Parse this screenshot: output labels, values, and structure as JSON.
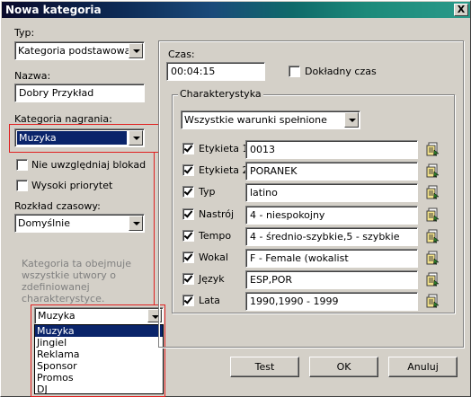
{
  "window": {
    "title": "Nowa kategoria",
    "close": "X"
  },
  "left": {
    "type_label": "Typ:",
    "type_value": "Kategoria podstawowa",
    "name_label": "Nazwa:",
    "name_value": "Dobry Przykład",
    "rec_cat_label": "Kategoria nagrania:",
    "rec_cat_value": "Muzyka",
    "ignore_locks_label": "Nie uwzględniaj blokad",
    "high_priority_label": "Wysoki priorytet",
    "schedule_label": "Rozkład czasowy:",
    "schedule_value": "Domyślnie",
    "info_text": [
      "Kategoria ta obejmuje",
      "wszystkie utwory o",
      "zdefiniowanej",
      "charakterystyce."
    ]
  },
  "dropdown": {
    "value": "Muzyka",
    "options": [
      "Muzyka",
      "Jingiel",
      "Reklama",
      "Sponsor",
      "Promos",
      "DJ"
    ],
    "highlighted": "Muzyka"
  },
  "right": {
    "time_label": "Czas:",
    "time_value": "00:04:15",
    "exact_time_label": "Dokładny czas",
    "group_title": "Charakterystyka",
    "condition_value": "Wszystkie warunki spełnione",
    "rows": [
      {
        "label": "Etykieta 1",
        "value": "0013",
        "checked": true
      },
      {
        "label": "Etykieta 2",
        "value": "PORANEK",
        "checked": true
      },
      {
        "label": "Typ",
        "value": "latino",
        "checked": true
      },
      {
        "label": "Nastrój",
        "value": "4 - niespokojny",
        "checked": true
      },
      {
        "label": "Tempo",
        "value": "4 - średnio-szybkie,5 - szybkie",
        "checked": true
      },
      {
        "label": "Wokal",
        "value": "F - Female (wokalist",
        "checked": true
      },
      {
        "label": "Język",
        "value": "ESP,POR",
        "checked": true
      },
      {
        "label": "Lata",
        "value": "1990,1990 - 1999",
        "checked": true
      }
    ]
  },
  "buttons": {
    "test": "Test",
    "ok": "OK",
    "cancel": "Anuluj"
  },
  "colors": {
    "highlight": "#0a246a",
    "annotation": "#e02020"
  }
}
